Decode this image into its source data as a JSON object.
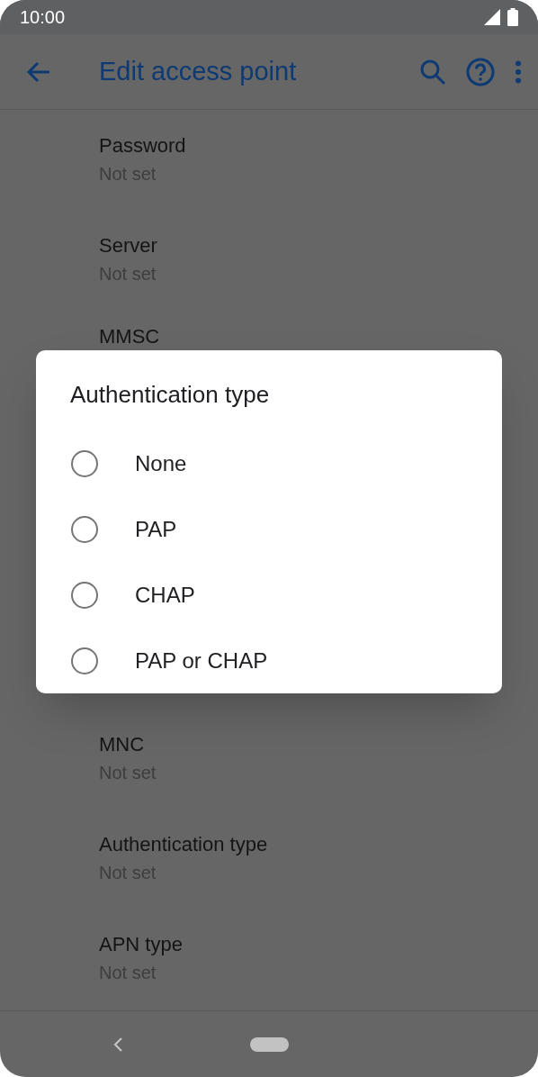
{
  "status_bar": {
    "time": "10:00"
  },
  "app_bar": {
    "title": "Edit access point"
  },
  "settings_above": [
    {
      "title": "Password",
      "subtitle": "Not set"
    },
    {
      "title": "Server",
      "subtitle": "Not set"
    },
    {
      "title": "MMSC"
    }
  ],
  "settings_below": [
    {
      "title": "MNC",
      "subtitle": "Not set"
    },
    {
      "title": "Authentication type",
      "subtitle": "Not set"
    },
    {
      "title": "APN type",
      "subtitle": "Not set"
    }
  ],
  "dialog": {
    "title": "Authentication type",
    "options": [
      {
        "label": "None",
        "selected": false
      },
      {
        "label": "PAP",
        "selected": false
      },
      {
        "label": "CHAP",
        "selected": false
      },
      {
        "label": "PAP or CHAP",
        "selected": false
      }
    ]
  }
}
